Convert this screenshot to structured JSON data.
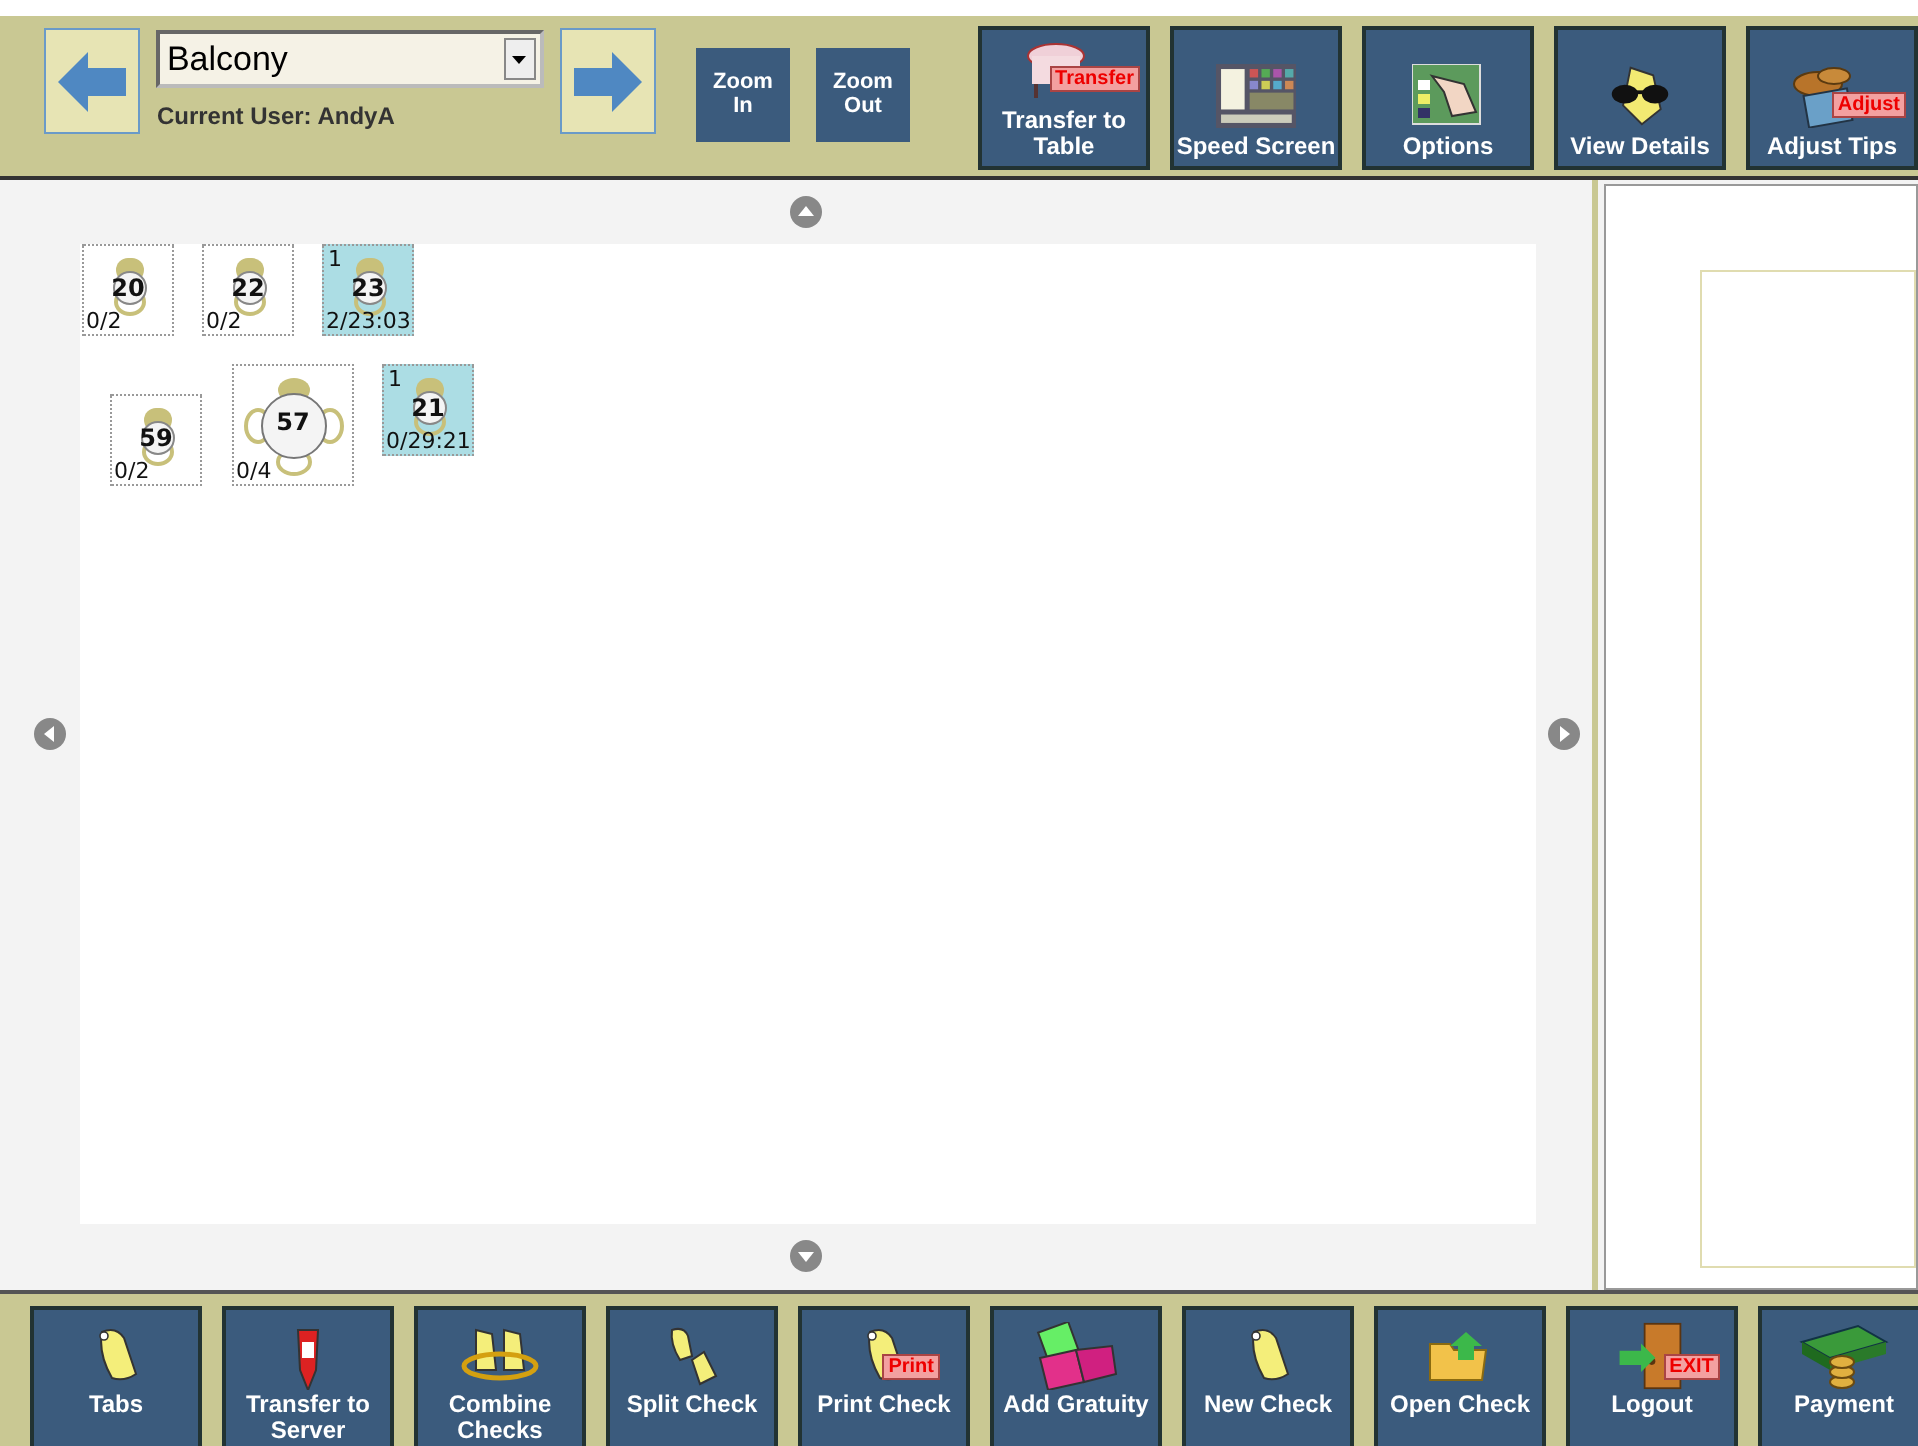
{
  "header": {
    "area": {
      "value": "Balcony"
    },
    "current_user": "Current User: AndyA",
    "zoom_buttons": [
      "Zoom In",
      "Zoom Out"
    ],
    "actions": [
      {
        "label": "Transfer to Table",
        "tag": "Transfer"
      },
      {
        "label": "Speed Screen"
      },
      {
        "label": "Options"
      },
      {
        "label": "View Details"
      },
      {
        "label": "Adjust Tips",
        "tag": "Adjust"
      }
    ]
  },
  "floor": {
    "tables": [
      {
        "number": "20",
        "kind": "two-top",
        "occupied": false,
        "status": "0/2"
      },
      {
        "number": "22",
        "kind": "two-top",
        "occupied": false,
        "status": "0/2"
      },
      {
        "number": "23",
        "kind": "two-top",
        "occupied": true,
        "guests": "1",
        "status": "2/23:03"
      },
      {
        "number": "59",
        "kind": "two-top",
        "occupied": false,
        "status": "0/2"
      },
      {
        "number": "57",
        "kind": "round-four",
        "occupied": false,
        "status": "0/4"
      },
      {
        "number": "21",
        "kind": "two-top",
        "occupied": true,
        "guests": "1",
        "status": "0/29:21"
      }
    ]
  },
  "footer": {
    "actions": [
      {
        "label": "Tabs"
      },
      {
        "label": "Transfer to Server"
      },
      {
        "label": "Combine Checks"
      },
      {
        "label": "Split Check"
      },
      {
        "label": "Print Check",
        "tag": "Print"
      },
      {
        "label": "Add Gratuity"
      },
      {
        "label": "New Check"
      },
      {
        "label": "Open Check"
      },
      {
        "label": "Logout",
        "tag": "EXIT"
      },
      {
        "label": "Payment"
      }
    ]
  }
}
